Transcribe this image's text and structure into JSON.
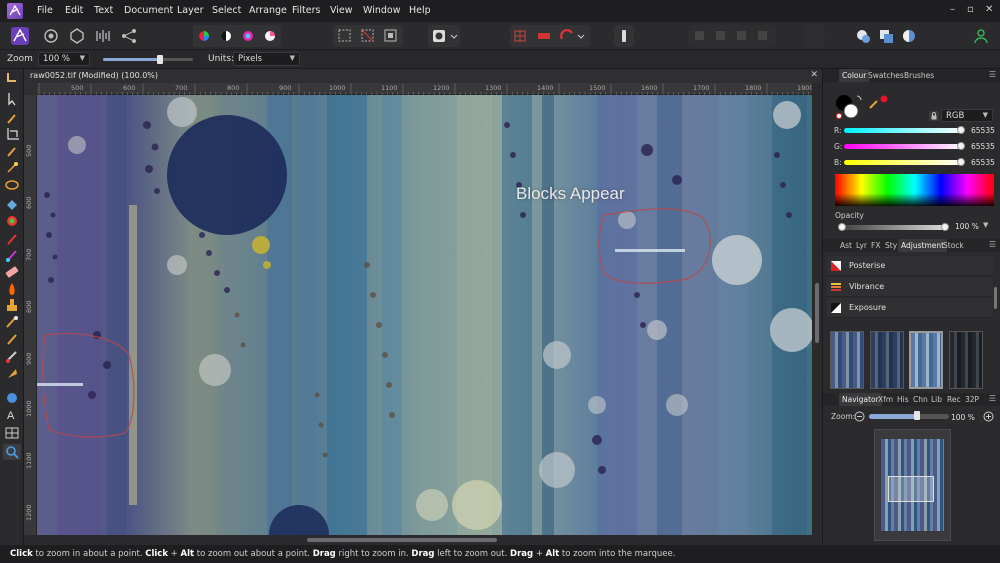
{
  "menu": [
    "File",
    "Edit",
    "Text",
    "Document",
    "Layer",
    "Select",
    "Arrange",
    "Filters",
    "View",
    "Window",
    "Help"
  ],
  "window_controls": [
    "–",
    "▫",
    "✕"
  ],
  "context": {
    "tool_label": "Zoom",
    "zoom_value": "100 %",
    "units_label": "Units:",
    "units_value": "Pixels"
  },
  "document": {
    "tab_title": "raw0052.tif (Modified) (100.0%)",
    "close_glyph": "✕",
    "ruler_h_ticks": [
      "500",
      "600",
      "700",
      "800",
      "900",
      "1000",
      "1100",
      "1200",
      "1300",
      "1400",
      "1500",
      "1600",
      "1700",
      "1800",
      "1900"
    ],
    "ruler_v_ticks": [
      "500",
      "600",
      "700",
      "800",
      "900",
      "1000",
      "1100",
      "1200",
      "1300"
    ],
    "overlay_caption": "Blocks Appear"
  },
  "colour_panel": {
    "tabs": [
      "Colour",
      "Swatches",
      "Brushes"
    ],
    "active_tab": "Colour",
    "model": "RGB",
    "channels": [
      {
        "label": "R:",
        "value": "65535"
      },
      {
        "label": "G:",
        "value": "65535"
      },
      {
        "label": "B:",
        "value": "65535"
      }
    ],
    "opacity_label": "Opacity",
    "opacity_value": "100 %",
    "accent_red": "#e5162a"
  },
  "adjustment_panel": {
    "tabs": [
      "Ast",
      "Lyr",
      "FX",
      "Sty",
      "Adjustment",
      "Stock"
    ],
    "active_tab": "Adjustment",
    "items": [
      "Posterise",
      "Vibrance",
      "Exposure"
    ]
  },
  "navigator_panel": {
    "tabs": [
      "Navigator",
      "Xfm",
      "His",
      "Chn",
      "Lib",
      "Rec",
      "32P"
    ],
    "active_tab": "Navigator",
    "zoom_label": "Zoom:",
    "zoom_value": "100 %"
  },
  "status": {
    "segments": [
      {
        "b": "Click",
        "t": " to zoom in about a point. "
      },
      {
        "b": "Click",
        "t": " + "
      },
      {
        "b": "Alt",
        "t": " to zoom out about a point. "
      },
      {
        "b": "Drag",
        "t": " right to zoom in. "
      },
      {
        "b": "Drag",
        "t": " left to zoom out. "
      },
      {
        "b": "Drag",
        "t": " + "
      },
      {
        "b": "Alt",
        "t": " to zoom into the marquee."
      }
    ]
  }
}
